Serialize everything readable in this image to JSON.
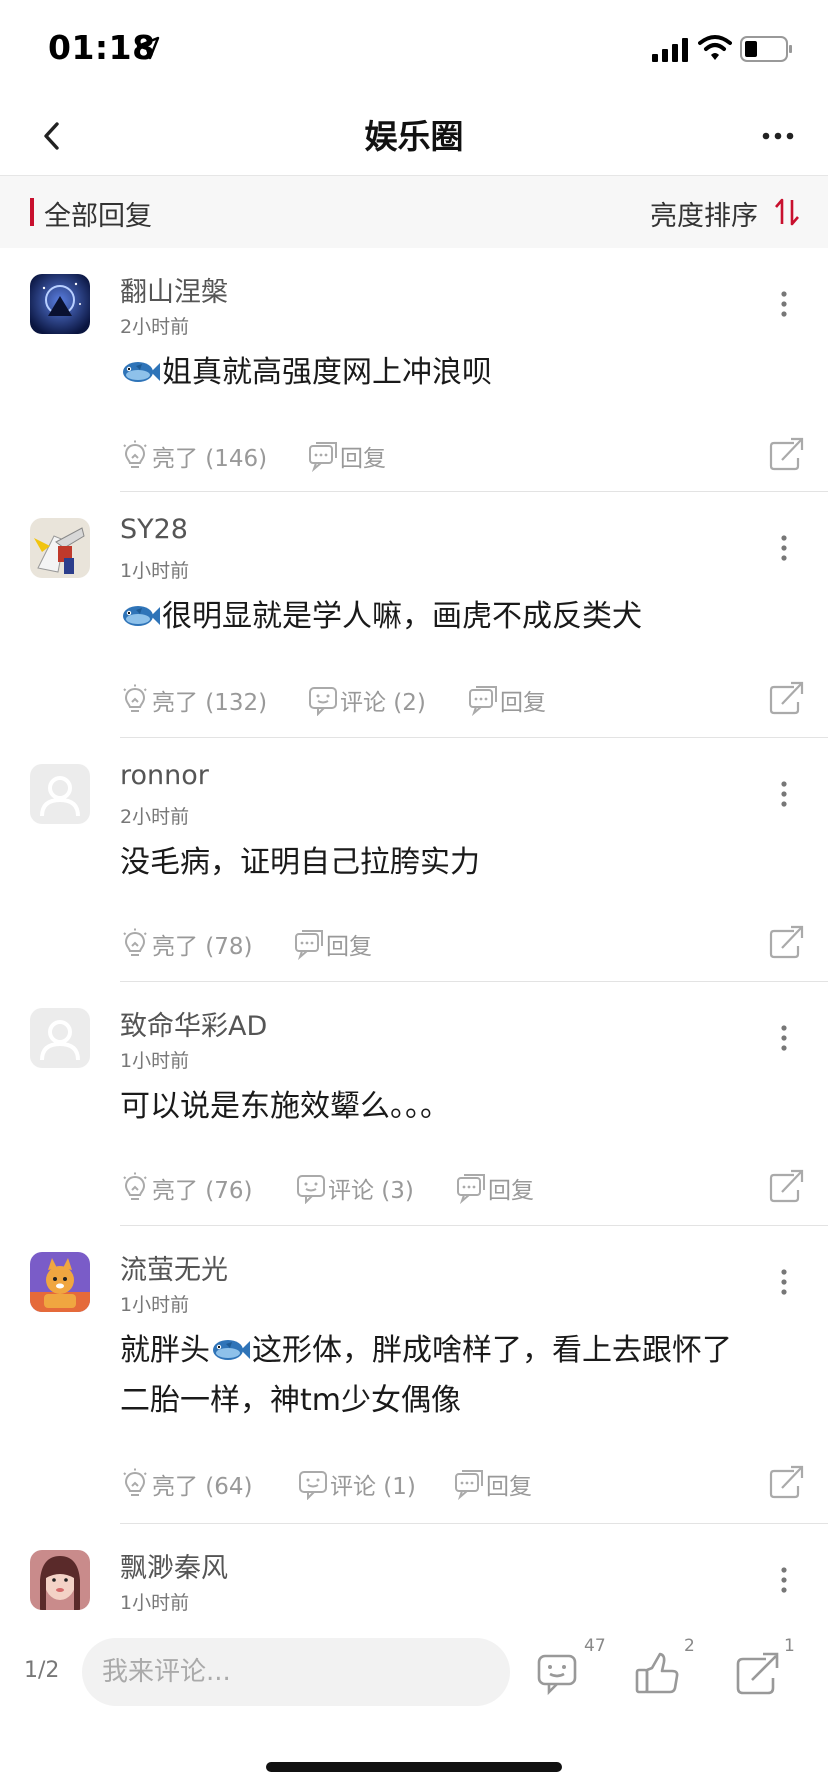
{
  "status_bar": {
    "time": "01:18"
  },
  "nav": {
    "title": "娱乐圈"
  },
  "section": {
    "title": "全部回复",
    "sort_label": "亮度排序"
  },
  "comments": [
    {
      "user": "翻山涅槃",
      "time": "2小时前",
      "text": "姐真就高强度网上冲浪呗",
      "fish": true,
      "like": "亮了 (146)",
      "comment": null,
      "reply": "回复"
    },
    {
      "user": "SY28",
      "time": "1小时前",
      "text": "很明显就是学人嘛，画虎不成反类犬",
      "fish": true,
      "like": "亮了 (132)",
      "comment": "评论 (2)",
      "reply": "回复"
    },
    {
      "user": "ronnor",
      "time": "2小时前",
      "text": "没毛病，证明自己拉胯实力",
      "fish": false,
      "like": "亮了 (78)",
      "comment": null,
      "reply": "回复"
    },
    {
      "user": "致命华彩AD",
      "time": "1小时前",
      "text": "可以说是东施效颦么。。。",
      "fish": false,
      "like": "亮了 (76)",
      "comment": "评论 (3)",
      "reply": "回复"
    },
    {
      "user": "流萤无光",
      "time": "1小时前",
      "text_a": "就胖头",
      "text_b": "这形体，胖成啥样了，看上去跟怀了",
      "text_c": "二胎一样，神tm少女偶像",
      "like": "亮了 (64)",
      "comment": "评论 (1)",
      "reply": "回复"
    },
    {
      "user": "飘渺秦风",
      "time": "1小时前"
    }
  ],
  "bottom_bar": {
    "page": "1/2",
    "input_placeholder": "我来评论...",
    "comment_count": "47",
    "like_count": "2",
    "share_count": "1"
  },
  "colors": {
    "accent": "#c8102e",
    "fish": "#2a6fb0"
  },
  "icons": [
    "location-arrow-icon",
    "signal-icon",
    "wifi-icon",
    "battery-icon",
    "back-chevron-icon",
    "more-dots-icon",
    "sort-icon",
    "bulb-icon",
    "reply-icon",
    "comment-icon",
    "share-icon",
    "kebab-icon",
    "fish-emoji-icon",
    "thumb-up-icon"
  ]
}
